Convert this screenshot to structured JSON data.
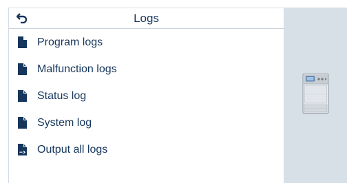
{
  "header": {
    "title": "Logs",
    "back_icon": "back-arrow-icon"
  },
  "menu": {
    "items": [
      {
        "label": "Program logs",
        "icon": "document-icon"
      },
      {
        "label": "Malfunction logs",
        "icon": "document-icon"
      },
      {
        "label": "Status log",
        "icon": "document-icon"
      },
      {
        "label": "System log",
        "icon": "document-icon"
      },
      {
        "label": "Output all logs",
        "icon": "document-output-icon"
      }
    ]
  },
  "side_panel": {
    "image": "dishwasher-machine-icon"
  },
  "colors": {
    "text": "#16365c",
    "icon": "#16365c",
    "side_panel_bg": "#d7e0e7",
    "divider": "#c9d2da"
  }
}
